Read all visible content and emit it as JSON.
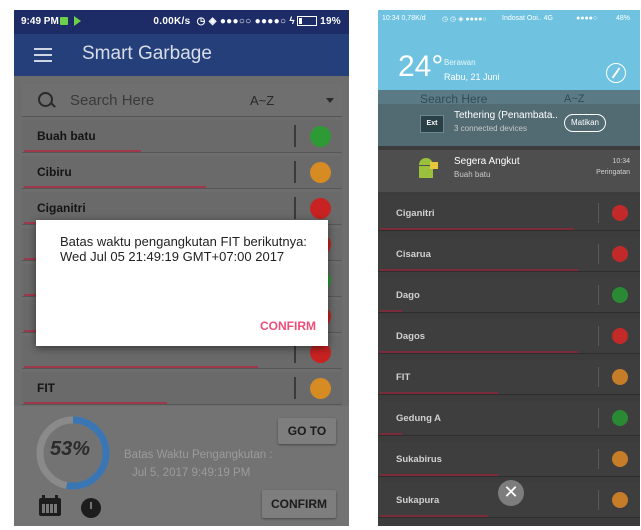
{
  "left": {
    "status": {
      "time": "9:49 PM",
      "right_text": "0.00K/s",
      "battery": "19%"
    },
    "app_title": "Smart Garbage",
    "search": {
      "placeholder": "Search Here",
      "sort": "A~Z"
    },
    "list": [
      {
        "name": "Buah batu",
        "status_color": "#2e9a35",
        "fill": 0.45
      },
      {
        "name": "Cibiru",
        "status_color": "#d68b23",
        "fill": 0.7
      },
      {
        "name": "Ciganitri",
        "status_color": "#c82222",
        "fill": 0.9
      },
      {
        "name": "",
        "status_color": "#c82222",
        "fill": 0.9
      },
      {
        "name": "",
        "status_color": "#2e9a35",
        "fill": 0.3
      },
      {
        "name": "",
        "status_color": "#c82222",
        "fill": 0.9
      },
      {
        "name": "",
        "status_color": "#c82222",
        "fill": 0.9
      },
      {
        "name": "FIT",
        "status_color": "#d68b23",
        "fill": 0.55
      }
    ],
    "panel": {
      "percent": "53%",
      "percent_value": 53,
      "gauge_color": "#3a76b3",
      "goto_label": "GO TO",
      "batas_label": "Batas Waktu Pengangkutan :",
      "batas_date": "Jul 5, 2017 9:49:19 PM",
      "confirm_label": "CONFIRM"
    },
    "dialog": {
      "message": "Batas waktu pengangkutan FIT berikutnya:\nWed Jul 05 21:49:19 GMT+07:00 2017",
      "confirm": "CONFIRM"
    }
  },
  "right": {
    "status": {
      "left_text": "10:34  0,78K/d",
      "carrier": "Indosat Ooi..  4G",
      "battery": "48%"
    },
    "weather": {
      "temperature": "24°",
      "condition": "Berawan",
      "date": "Rabu, 21 Juni"
    },
    "background_search": {
      "placeholder": "Search Here",
      "sort": "A~Z"
    },
    "notifications": [
      {
        "icon": "ext-icon",
        "title": "Tethering (Penambata..",
        "subtitle": "3 connected devices",
        "action": "Matikan"
      },
      {
        "icon": "android-icon",
        "title": "Segera Angkut",
        "subtitle": "Buah batu",
        "time": "10:34",
        "tag": "Peringatan"
      }
    ],
    "list": [
      {
        "name": "Ciganitri",
        "status_color": "#c22a2a",
        "fill": 0.9
      },
      {
        "name": "Cisarua",
        "status_color": "#c22a2a",
        "fill": 0.92
      },
      {
        "name": "Dago",
        "status_color": "#2a8a33",
        "fill": 0.1
      },
      {
        "name": "Dagos",
        "status_color": "#c22a2a",
        "fill": 0.92
      },
      {
        "name": "FIT",
        "status_color": "#c77d28",
        "fill": 0.55
      },
      {
        "name": "Gedung A",
        "status_color": "#2a8a33",
        "fill": 0.1
      },
      {
        "name": "Sukabirus",
        "status_color": "#c77d28",
        "fill": 0.55
      },
      {
        "name": "Sukapura",
        "status_color": "#c77d28",
        "fill": 0.5
      }
    ],
    "close_label": "✕"
  }
}
